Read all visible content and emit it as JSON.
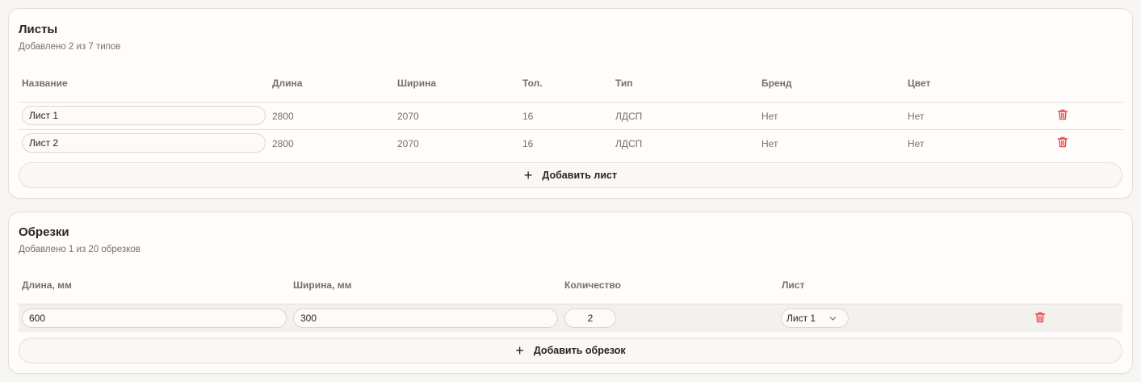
{
  "sheets": {
    "title": "Листы",
    "subtitle": "Добавлено 2 из 7 типов",
    "columns": [
      "Название",
      "Длина",
      "Ширина",
      "Тол.",
      "Тип",
      "Бренд",
      "Цвет"
    ],
    "rows": [
      {
        "name": "Лист 1",
        "length": "2800",
        "width": "2070",
        "thickness": "16",
        "type": "ЛДСП",
        "brand": "Нет",
        "color": "Нет"
      },
      {
        "name": "Лист 2",
        "length": "2800",
        "width": "2070",
        "thickness": "16",
        "type": "ЛДСП",
        "brand": "Нет",
        "color": "Нет"
      }
    ],
    "add_label": "Добавить лист"
  },
  "offcuts": {
    "title": "Обрезки",
    "subtitle": "Добавлено 1 из 20 обрезков",
    "columns": [
      "Длина, мм",
      "Ширина, мм",
      "Количество",
      "Лист"
    ],
    "rows": [
      {
        "length": "600",
        "width": "300",
        "quantity": "2",
        "sheet": "Лист 1"
      }
    ],
    "add_label": "Добавить обрезок"
  },
  "icons": {
    "delete": "trash-icon",
    "add": "plus-icon",
    "select": "chevron-down-icon"
  },
  "colors": {
    "danger": "#e5484d",
    "muted_text": "#7a6e64",
    "border": "#e4dfd9"
  }
}
